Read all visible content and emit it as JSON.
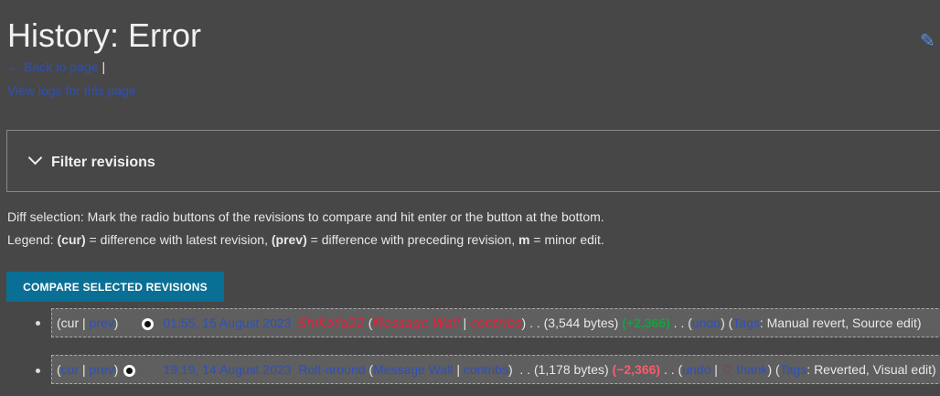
{
  "title": "History: Error",
  "back_link": "Back to page",
  "separator": "|",
  "logs_link": "View logs for this page",
  "filter_label": "Filter revisions",
  "diff_help": "Diff selection: Mark the radio buttons of the revisions to compare and hit enter or the button at the bottom.",
  "legend": {
    "prefix": "Legend: ",
    "cur": "(cur)",
    "cur_desc": " = difference with latest revision, ",
    "prev": "(prev)",
    "prev_desc": " = difference with preceding revision, ",
    "m": "m",
    "m_desc": " = minor edit."
  },
  "compare_button": "COMPARE SELECTED REVISIONS",
  "revisions": [
    {
      "cur": "cur",
      "prev": "prev",
      "date": "01:55, 15 August 2023",
      "user": "ShiKoYa22",
      "wall": "Message Wall",
      "contribs": "contribs",
      "bytes": "(3,544 bytes)",
      "diff": "(+2,366)",
      "undo": "undo",
      "tags_label": "Tags",
      "tags": ": Manual revert, Source edit)"
    },
    {
      "cur": "cur",
      "prev": "prev",
      "date": "19:19, 14 August 2023",
      "user": "Rolt-around",
      "wall": "Message Wall",
      "contribs": "contribs",
      "bytes": "(1,178 bytes)",
      "diff": "(−2,366)",
      "undo": "undo",
      "thank": "thank",
      "tags_label": "Tags",
      "tags": ": Reverted, Visual edit)"
    }
  ]
}
